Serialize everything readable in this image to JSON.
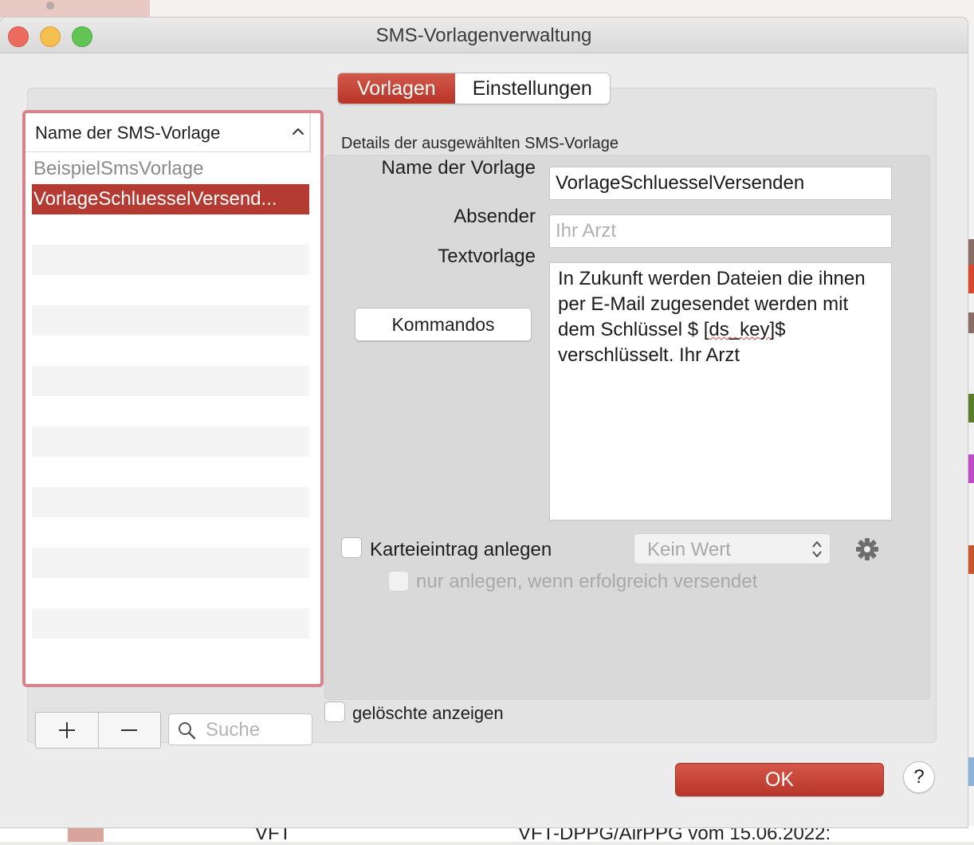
{
  "window": {
    "title": "SMS-Vorlagenverwaltung"
  },
  "tabs": [
    {
      "label": "Vorlagen",
      "active": true
    },
    {
      "label": "Einstellungen",
      "active": false
    }
  ],
  "list": {
    "header": "Name der SMS-Vorlage",
    "items": [
      {
        "label": "BeispielSmsVorlage",
        "state": "muted"
      },
      {
        "label": "VorlageSchluesselVersend...",
        "state": "selected"
      }
    ]
  },
  "details": {
    "caption": "Details der ausgewählten SMS-Vorlage",
    "name_label": "Name der Vorlage",
    "name_value": "VorlageSchluesselVersenden",
    "sender_label": "Absender",
    "sender_placeholder": "Ihr Arzt",
    "text_label": "Textvorlage",
    "commands_button": "Kommandos",
    "text_before": "In Zukunft werden Dateien die ihnen per E-Mail zugesendet werden mit dem Schlüssel $ [",
    "text_misspelled": "ds_key",
    "text_after": "]$ verschlüsselt. Ihr Arzt",
    "karteieintrag_label": "Karteieintrag anlegen",
    "karteieintrag_checked": false,
    "select_value": "Kein Wert",
    "only_success_label": "nur anlegen, wenn erfolgreich versendet",
    "only_success_checked": false
  },
  "bottom": {
    "search_placeholder": "Suche",
    "show_deleted_label": "gelöschte anzeigen",
    "show_deleted_checked": false,
    "ok_label": "OK",
    "help_label": "?"
  },
  "background_text": {
    "left": "VFT",
    "right": "VFT-DPPG/AirPPG vom 15.06.2022:"
  },
  "colors": {
    "accent_red": "#b53a31",
    "selection": "#b53a31",
    "highlight_outline": "#d68488"
  },
  "icons": {
    "sort": "chevron-up-icon",
    "add": "plus-icon",
    "remove": "minus-icon",
    "search": "magnifier-icon",
    "settings": "gear-icon",
    "select": "up-down-arrows-icon"
  }
}
